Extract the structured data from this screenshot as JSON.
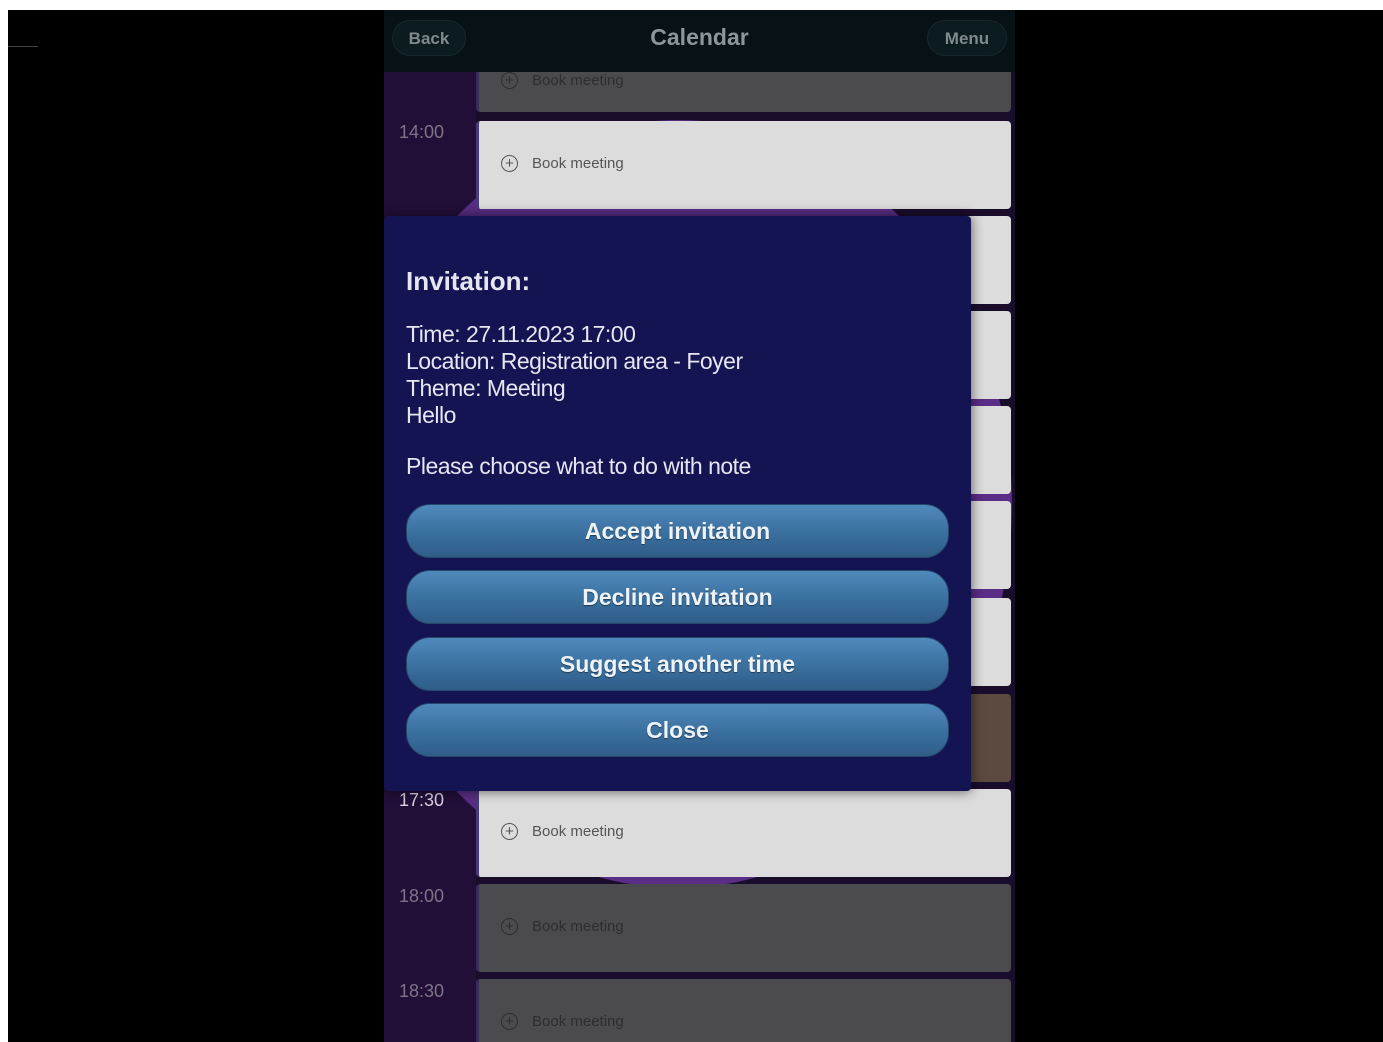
{
  "header": {
    "back_label": "Back",
    "title": "Calendar",
    "menu_label": "Menu"
  },
  "slots": [
    {
      "time": "",
      "book_label": "Book meeting"
    },
    {
      "time": "14:00",
      "book_label": "Book meeting"
    },
    {
      "time": "17:30",
      "book_label": "Book meeting"
    },
    {
      "time": "18:00",
      "book_label": "Book meeting"
    },
    {
      "time": "18:30",
      "book_label": "Book meeting"
    }
  ],
  "dialog": {
    "title": "Invitation:",
    "time_line": "Time: 27.11.2023 17:00",
    "location_line": "Location: Registration area - Foyer",
    "theme_line": "Theme: Meeting",
    "message_line": "Hello",
    "prompt": "Please choose what to do with note",
    "buttons": {
      "accept": "Accept invitation",
      "decline": "Decline invitation",
      "suggest": "Suggest another time",
      "close": "Close"
    }
  },
  "colors": {
    "dialog_bg": "#141452",
    "button_accent": "#3a6f9e",
    "header_bg": "#061216"
  },
  "icons": {
    "book_slot_icon": "plus-circle-icon"
  }
}
